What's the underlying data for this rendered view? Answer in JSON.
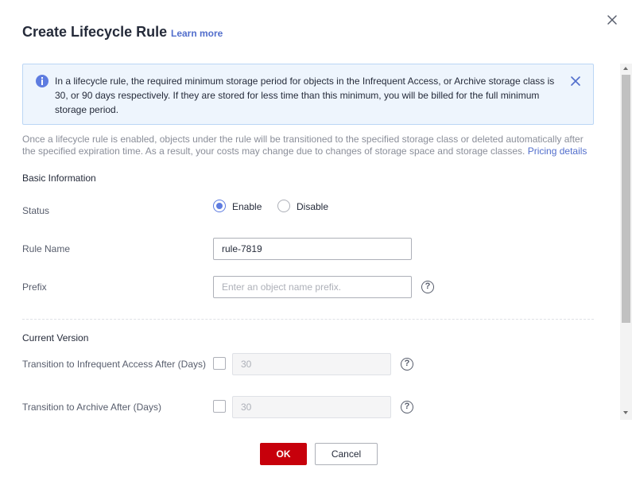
{
  "dialog": {
    "title": "Create Lifecycle Rule",
    "learn_more": "Learn more"
  },
  "notice": {
    "text": "In a lifecycle rule, the required minimum storage period for objects in the Infrequent Access, or Archive storage class is 30, or 90 days respectively. If they are stored for less time than this minimum, you will be billed for the full minimum storage period."
  },
  "description": {
    "text": "Once a lifecycle rule is enabled, objects under the rule will be transitioned to the specified storage class or deleted automatically after the specified expiration time. As a result, your costs may change due to changes of storage space and storage classes.",
    "link": "Pricing details"
  },
  "basic_info": {
    "section_title": "Basic Information",
    "status_label": "Status",
    "status_options": [
      "Enable",
      "Disable"
    ],
    "status_selected": "Enable",
    "rule_name_label": "Rule Name",
    "rule_name_value": "rule-7819",
    "prefix_label": "Prefix",
    "prefix_placeholder": "Enter an object name prefix.",
    "prefix_value": ""
  },
  "current_version": {
    "section_title": "Current Version",
    "ia_label": "Transition to Infrequent Access After (Days)",
    "ia_checked": false,
    "ia_value": "30",
    "archive_label": "Transition to Archive After (Days)",
    "archive_checked": false,
    "archive_value": "30"
  },
  "footer": {
    "ok_label": "OK",
    "cancel_label": "Cancel"
  },
  "colors": {
    "primary_button": "#c7000b",
    "link": "#526ecc",
    "radio_accent": "#5e7ce0",
    "notice_bg": "#eef5fd"
  },
  "icons": {
    "close": "close-icon",
    "info": "info-icon",
    "help": "question-mark-circle-icon"
  }
}
